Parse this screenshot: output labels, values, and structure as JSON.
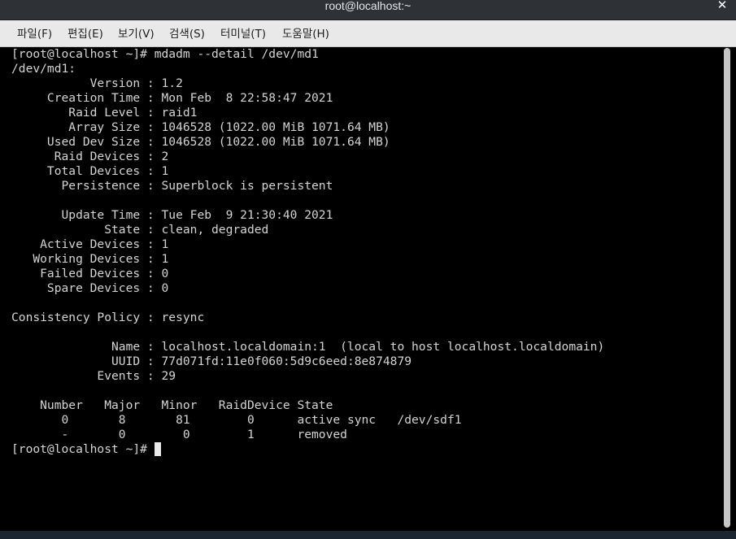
{
  "window": {
    "title": "root@localhost:~",
    "close_label": "✕"
  },
  "menu": {
    "items": [
      {
        "label": "파일(F)"
      },
      {
        "label": "편집(E)"
      },
      {
        "label": "보기(V)"
      },
      {
        "label": "검색(S)"
      },
      {
        "label": "터미널(T)"
      },
      {
        "label": "도움말(H)"
      }
    ]
  },
  "terminal": {
    "lines": [
      "[root@localhost ~]# mdadm --detail /dev/md1",
      "/dev/md1:",
      "           Version : 1.2",
      "     Creation Time : Mon Feb  8 22:58:47 2021",
      "        Raid Level : raid1",
      "        Array Size : 1046528 (1022.00 MiB 1071.64 MB)",
      "     Used Dev Size : 1046528 (1022.00 MiB 1071.64 MB)",
      "      Raid Devices : 2",
      "     Total Devices : 1",
      "       Persistence : Superblock is persistent",
      "",
      "       Update Time : Tue Feb  9 21:30:40 2021",
      "             State : clean, degraded",
      "    Active Devices : 1",
      "   Working Devices : 1",
      "    Failed Devices : 0",
      "     Spare Devices : 0",
      "",
      "Consistency Policy : resync",
      "",
      "              Name : localhost.localdomain:1  (local to host localhost.localdomain)",
      "              UUID : 77d071fd:11e0f060:5d9c6eed:8e874879",
      "            Events : 29",
      "",
      "    Number   Major   Minor   RaidDevice State",
      "       0       8       81        0      active sync   /dev/sdf1",
      "       -       0        0        1      removed",
      "[root@localhost ~]# "
    ]
  }
}
